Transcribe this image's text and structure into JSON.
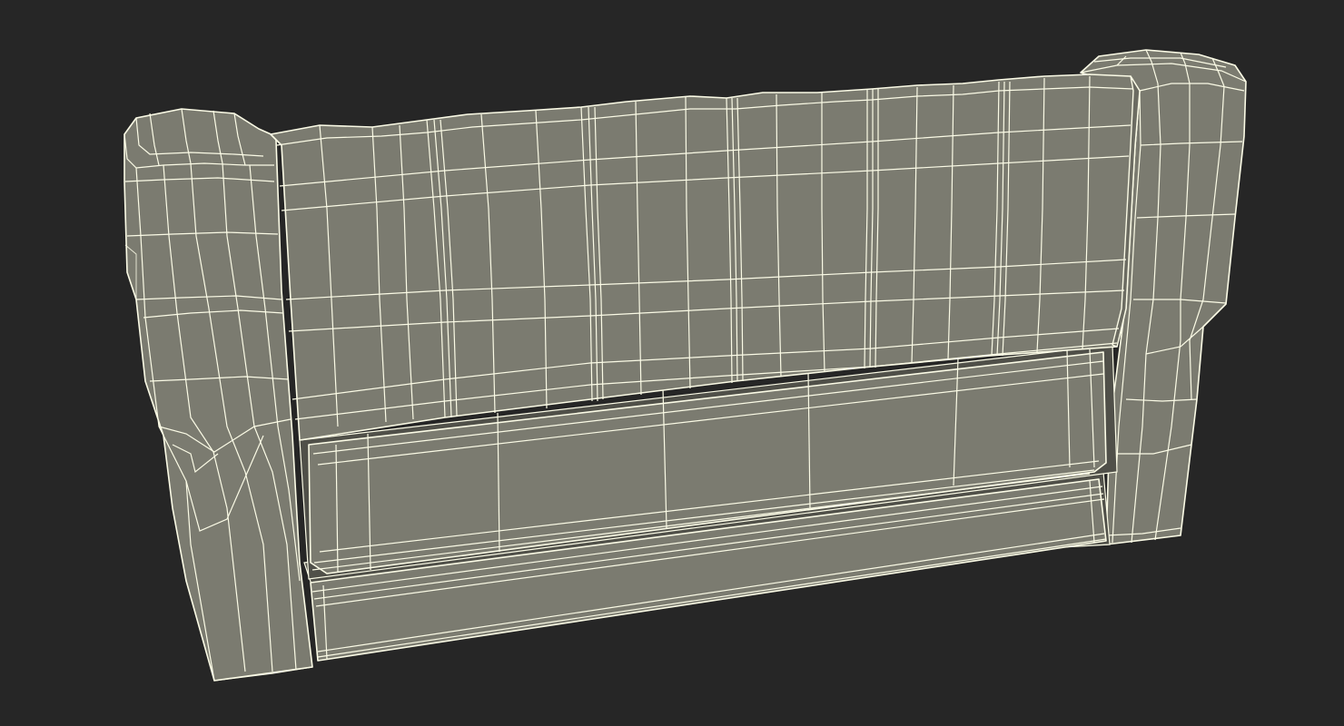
{
  "scene": {
    "subject": "sofa-wireframe-rear-view",
    "background_color": "#262626",
    "surface_color": "#7b7b70",
    "wire_color": "#fbfbe6"
  }
}
